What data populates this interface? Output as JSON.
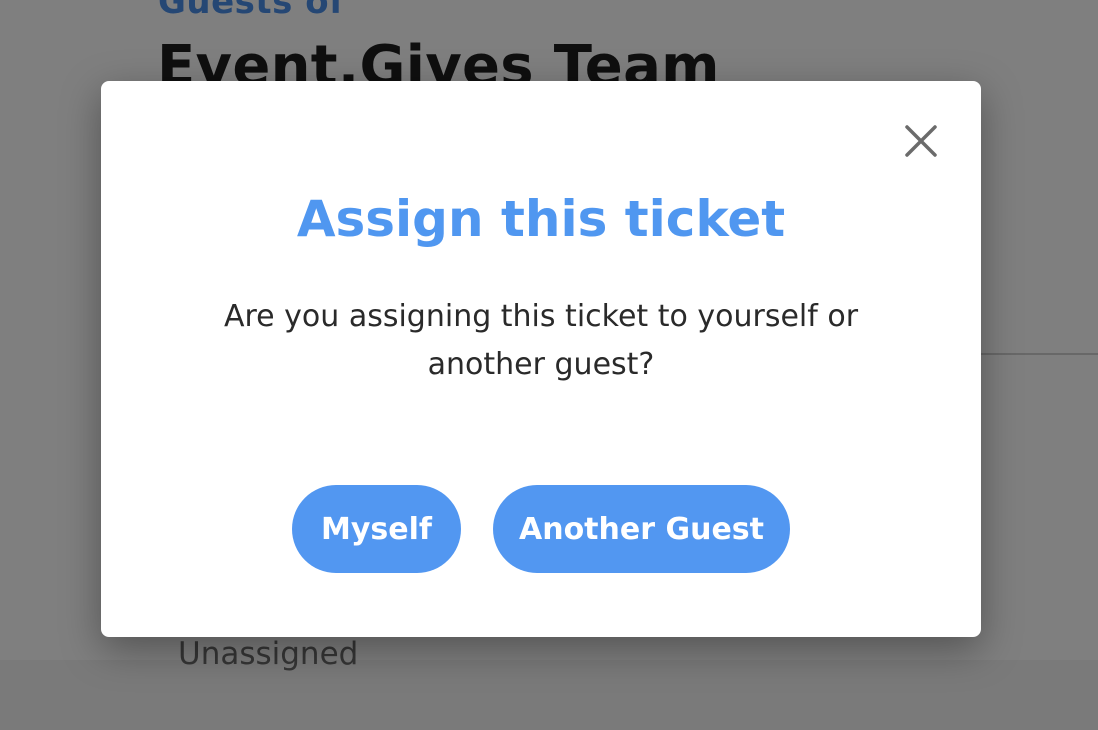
{
  "background": {
    "subtitle": "Guests of",
    "title": "Event.Gives Team",
    "ticket_status": "Unassigned"
  },
  "modal": {
    "title": "Assign this ticket",
    "body_line1": "Are you assigning this ticket to yourself or",
    "body_line2": "another guest?",
    "close_icon": "close-icon",
    "buttons": {
      "myself": "Myself",
      "another_guest": "Another Guest"
    }
  },
  "colors": {
    "accent": "#5297f1",
    "title": "#5097f0",
    "overlay": "rgba(0,0,0,0.5)"
  }
}
